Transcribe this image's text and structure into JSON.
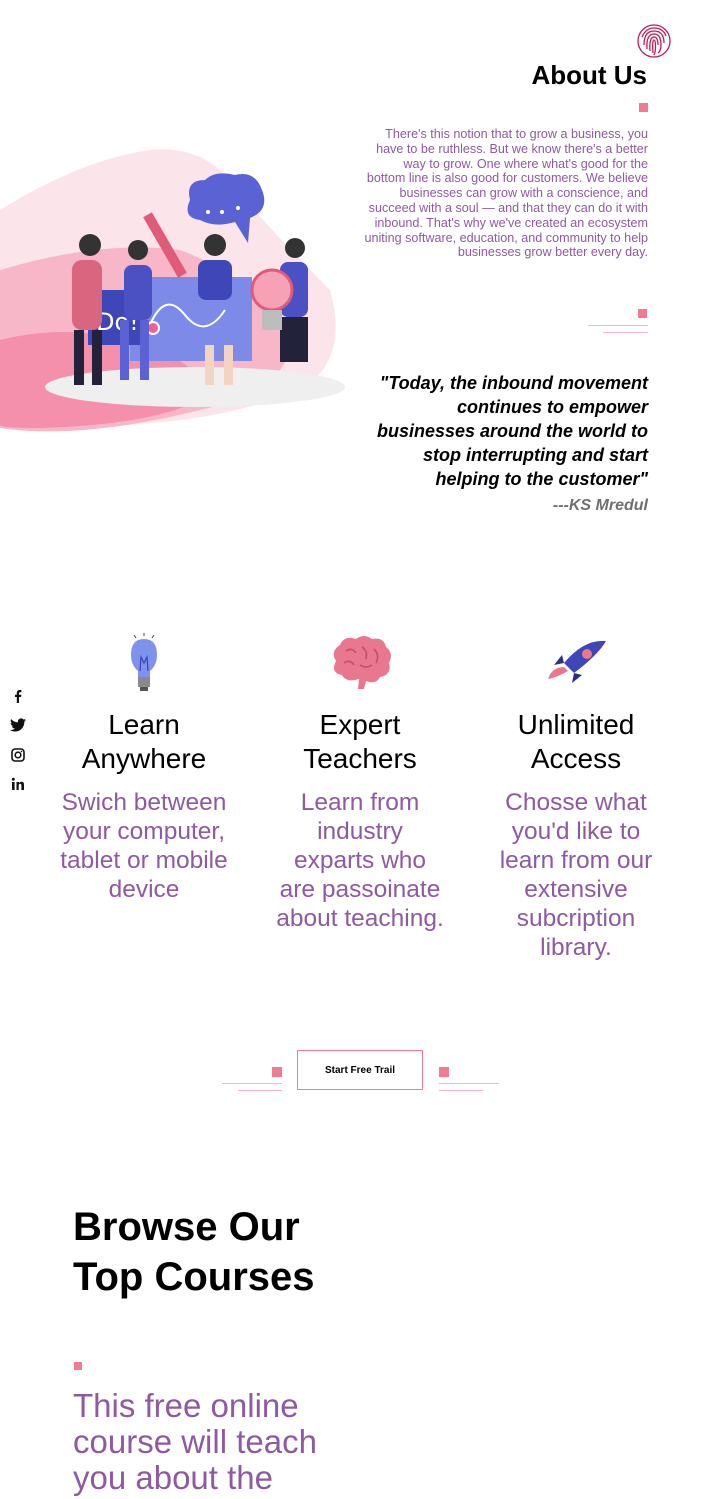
{
  "colors": {
    "accent": "#f27a93",
    "purple_text": "#8e5aa0",
    "quote_author": "#6f6f6f"
  },
  "logo": {
    "icon": "fingerprint-icon"
  },
  "about": {
    "title": "About Us",
    "text": "There's this notion that to grow a business, you have to be ruthless. But we know there's a better way to grow. One where what's good for the bottom line is also good for customers. We believe businesses can grow with a conscience, and succeed with a soul — and that they can do it with inbound. That's why we've created an ecosystem uniting software, education, and community to help businesses grow better every day.",
    "quote": "\"Today, the inbound movement continues to empower businesses around the world to stop interrupting and start helping to the customer\"",
    "quote_author": "---KS Mredul"
  },
  "social": [
    {
      "name": "facebook-icon",
      "glyph": "f"
    },
    {
      "name": "twitter-icon",
      "glyph": "twitter"
    },
    {
      "name": "instagram-icon",
      "glyph": "instagram"
    },
    {
      "name": "linkedin-icon",
      "glyph": "in"
    }
  ],
  "features": [
    {
      "icon": "lightbulb-icon",
      "title": "Learn Anywhere",
      "desc": "Swich between your computer, tablet or mobile device"
    },
    {
      "icon": "brain-icon",
      "title": "Expert Teachers",
      "desc": "Learn from industry exparts who are passoinate about teaching."
    },
    {
      "icon": "rocket-icon",
      "title": "Unlimited Access",
      "desc": "Chosse what you'd like to learn from our extensive subcription library."
    }
  ],
  "cta": {
    "label": "Start Free Trail"
  },
  "browse": {
    "title": "Browse Our Top Courses",
    "desc": "This free online course will teach you about the"
  },
  "hero": {
    "sign_text": "Do!"
  }
}
